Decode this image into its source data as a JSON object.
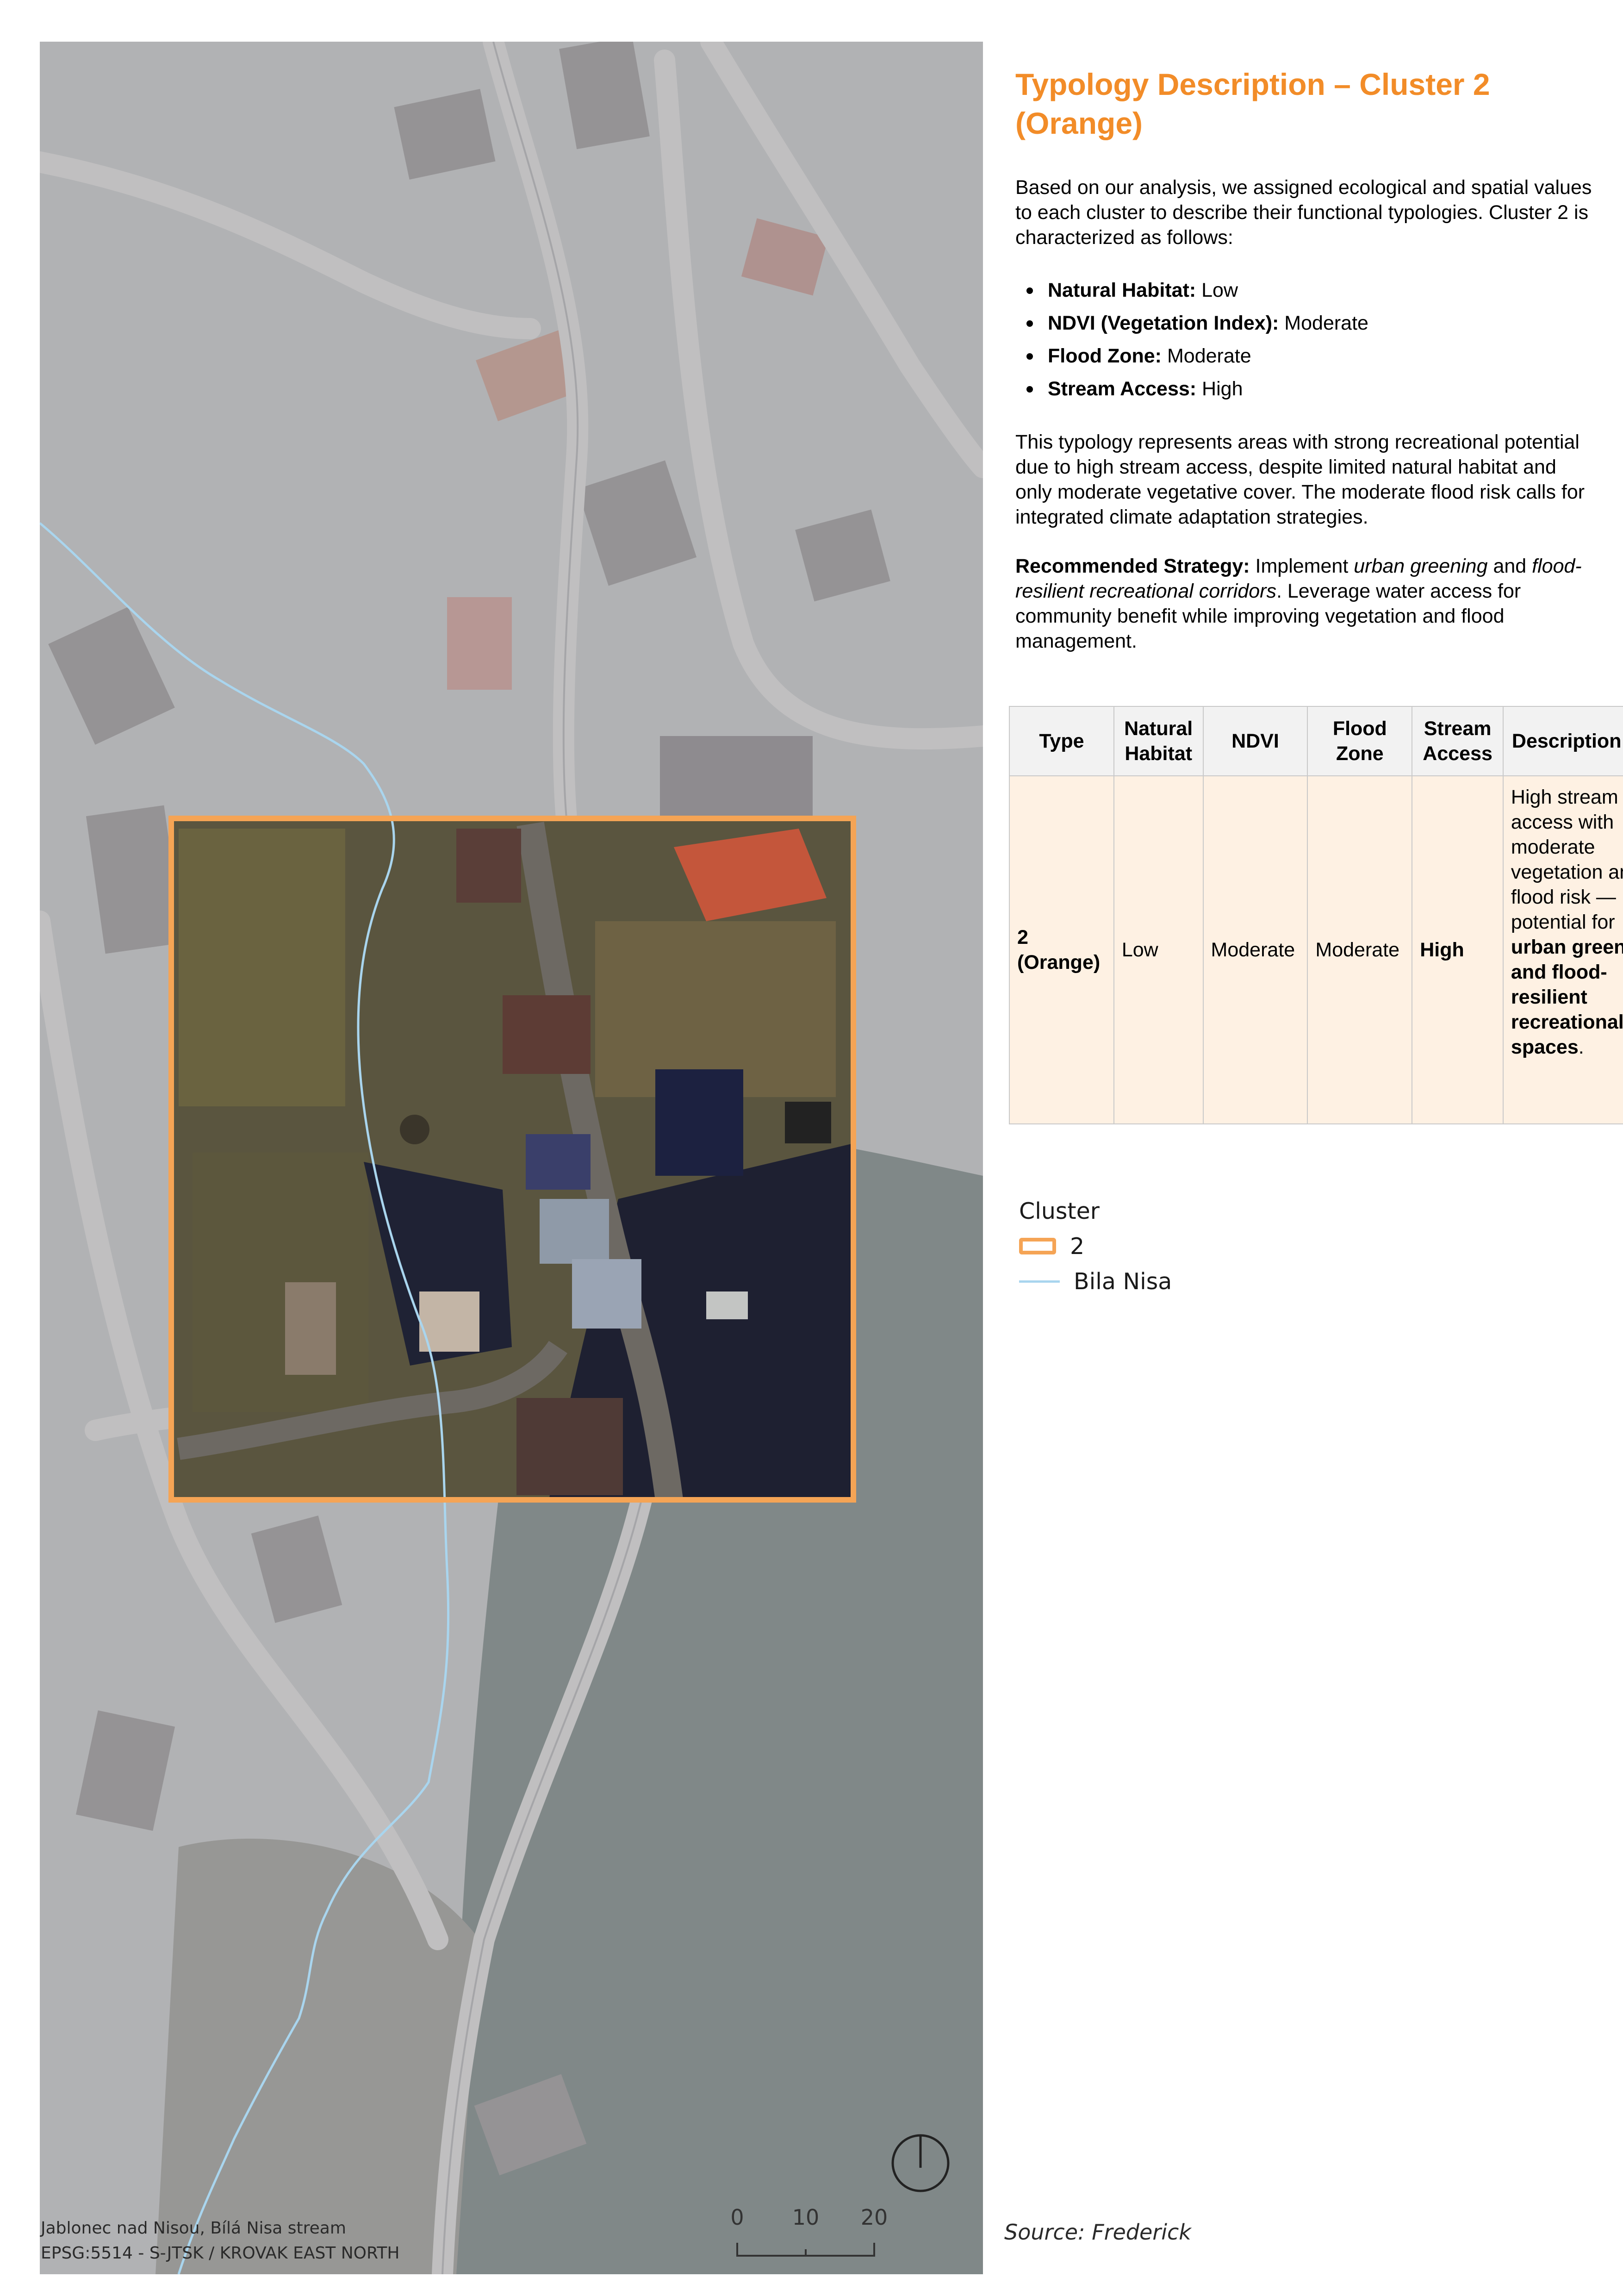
{
  "map": {
    "caption_line1": "Jablonec nad Nisou, Bílá Nisa stream",
    "caption_line2": "EPSG:5514 - S-JTSK / KROVAK EAST NORTH",
    "scale": {
      "labels": [
        "0",
        "10",
        "20"
      ]
    },
    "colors": {
      "cluster_outline": "#f5a455",
      "stream": "#a9d5ee",
      "fade_overlay": "#b8bcc8"
    }
  },
  "panel": {
    "title": "Typology Description – Cluster 2 (Orange)",
    "intro": "Based on our analysis, we assigned ecological and spatial values to each cluster to describe their functional typologies. Cluster 2 is characterized as follows:",
    "attributes": [
      {
        "label": "Natural Habitat:",
        "value": "Low"
      },
      {
        "label": "NDVI (Vegetation Index):",
        "value": "Moderate"
      },
      {
        "label": "Flood Zone:",
        "value": "Moderate"
      },
      {
        "label": "Stream Access:",
        "value": "High"
      }
    ],
    "paragraph2": "This typology represents areas with strong recreational potential due to high stream access, despite limited natural habitat and only moderate vegetative cover. The moderate flood risk calls for integrated climate adaptation strategies.",
    "strategy": {
      "label": "Recommended Strategy:",
      "text1": " Implement ",
      "em1": "urban greening",
      "text2": " and ",
      "em2": "flood-resilient recreational corridors",
      "text3": ". Leverage water access for community benefit while improving vegetation and flood management."
    },
    "accent_color": "#f28c28"
  },
  "table": {
    "headers": [
      "Type",
      "Natural Habitat",
      "NDVI",
      "Flood Zone",
      "Stream Access",
      "Description"
    ],
    "row": {
      "type": "2 (Orange)",
      "natural_habitat": "Low",
      "ndvi": "Moderate",
      "flood_zone": "Moderate",
      "stream_access": "High",
      "desc_plain": "High stream access with moderate vegetation and flood risk — potential for ",
      "desc_bold": "urban greening and flood-resilient recreational spaces",
      "desc_end": "."
    }
  },
  "legend": {
    "title": "Cluster",
    "item_cluster": "2",
    "item_stream": "Bila Nisa"
  },
  "source": "Source: Frederick"
}
